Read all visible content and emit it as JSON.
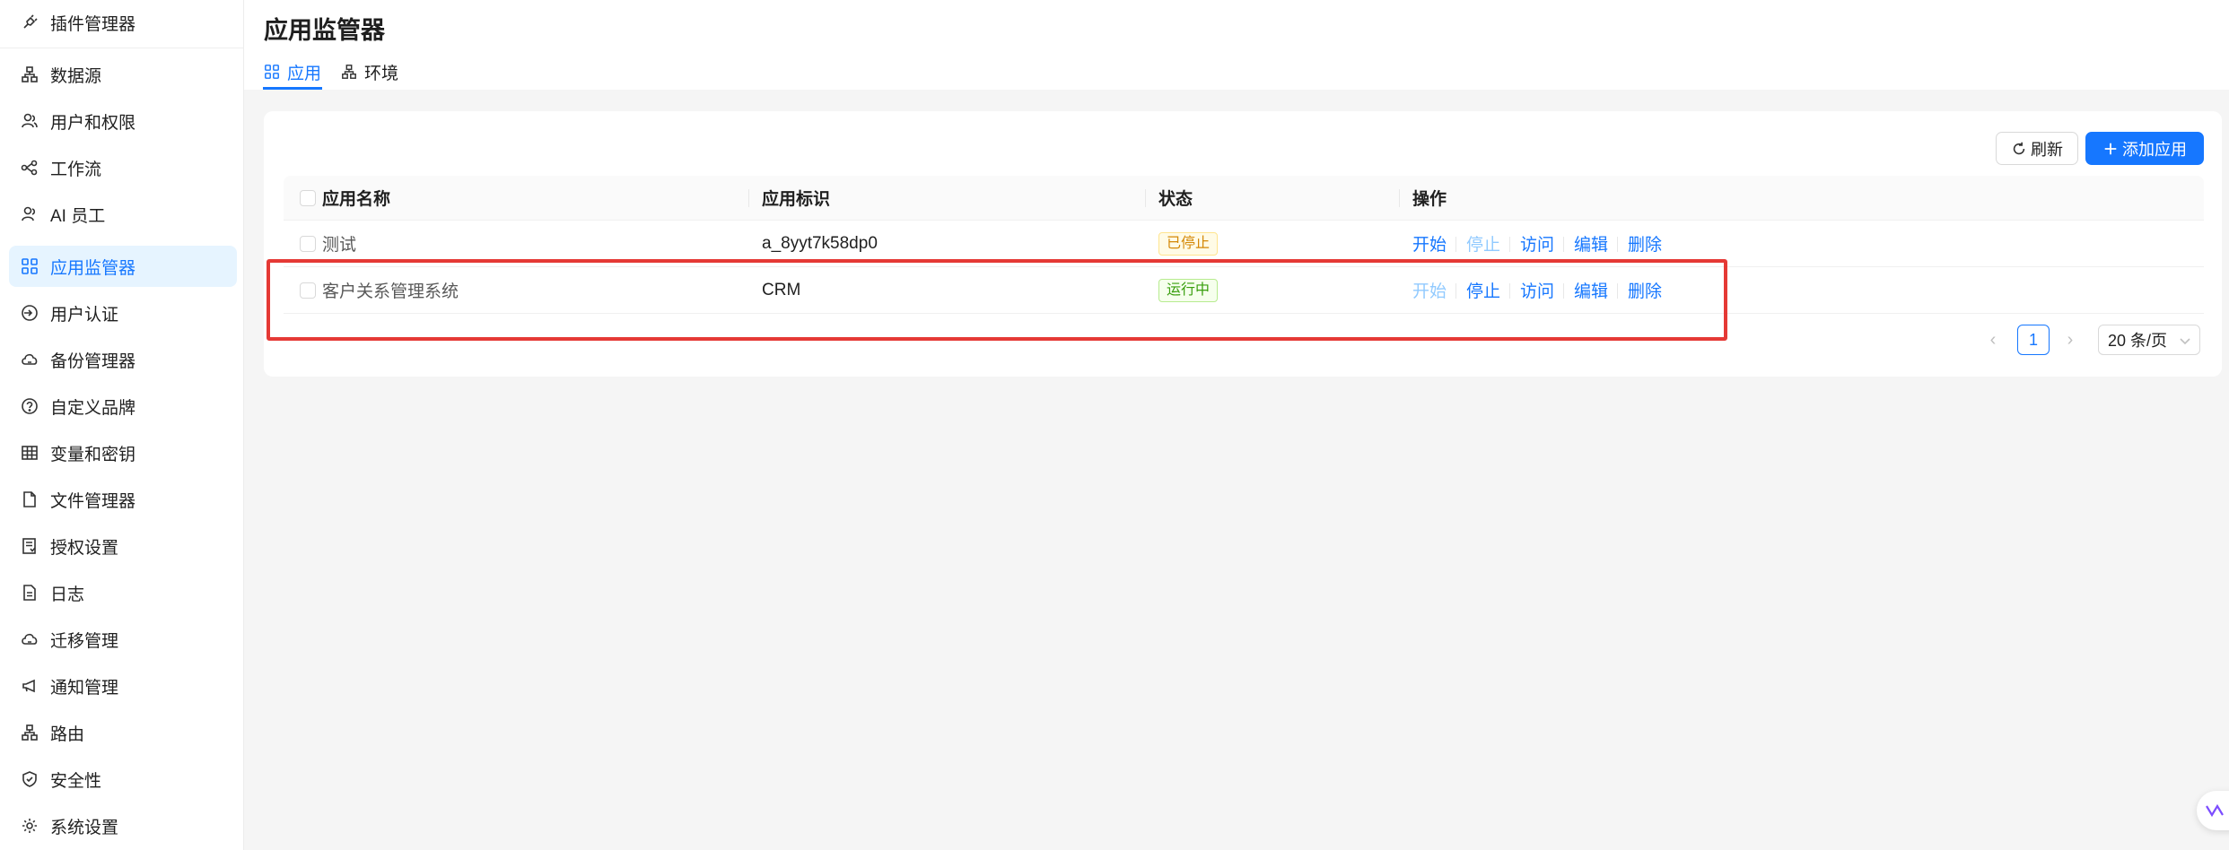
{
  "sidebar": {
    "items": [
      {
        "label": "插件管理器",
        "icon": "plug-icon"
      },
      {
        "label": "数据源",
        "icon": "database-icon"
      },
      {
        "label": "用户和权限",
        "icon": "users-icon"
      },
      {
        "label": "工作流",
        "icon": "workflow-icon"
      },
      {
        "label": "AI 员工",
        "icon": "ai-user-icon"
      },
      {
        "label": "应用监管器",
        "icon": "apps-grid-icon",
        "active": true
      },
      {
        "label": "用户认证",
        "icon": "login-icon"
      },
      {
        "label": "备份管理器",
        "icon": "cloud-backup-icon"
      },
      {
        "label": "自定义品牌",
        "icon": "question-circle-icon"
      },
      {
        "label": "变量和密钥",
        "icon": "table-icon"
      },
      {
        "label": "文件管理器",
        "icon": "file-icon"
      },
      {
        "label": "授权设置",
        "icon": "license-icon"
      },
      {
        "label": "日志",
        "icon": "log-file-icon"
      },
      {
        "label": "迁移管理",
        "icon": "cloud-migrate-icon"
      },
      {
        "label": "通知管理",
        "icon": "megaphone-icon"
      },
      {
        "label": "路由",
        "icon": "route-icon"
      },
      {
        "label": "安全性",
        "icon": "shield-icon"
      },
      {
        "label": "系统设置",
        "icon": "gear-icon"
      }
    ]
  },
  "header": {
    "title": "应用监管器",
    "tabs": [
      {
        "label": "应用",
        "active": true
      },
      {
        "label": "环境"
      }
    ]
  },
  "toolbar": {
    "refresh_label": "刷新",
    "add_label": "添加应用"
  },
  "table": {
    "columns": [
      "应用名称",
      "应用标识",
      "状态",
      "操作"
    ],
    "rows": [
      {
        "name": "测试",
        "id": "a_8yyt7k58dp0",
        "status": "已停止",
        "actions": [
          "开始",
          "停止",
          "访问",
          "编辑",
          "删除"
        ]
      },
      {
        "name": "客户关系管理系统",
        "id": "CRM",
        "status": "运行中",
        "actions": [
          "开始",
          "停止",
          "访问",
          "编辑",
          "删除"
        ]
      }
    ]
  },
  "pagination": {
    "current_page": "1",
    "page_size": "20 条/页"
  },
  "colors": {
    "accent": "#1677ff",
    "highlight": "#e53935",
    "stopped": "#d48806",
    "running": "#389e0d"
  }
}
